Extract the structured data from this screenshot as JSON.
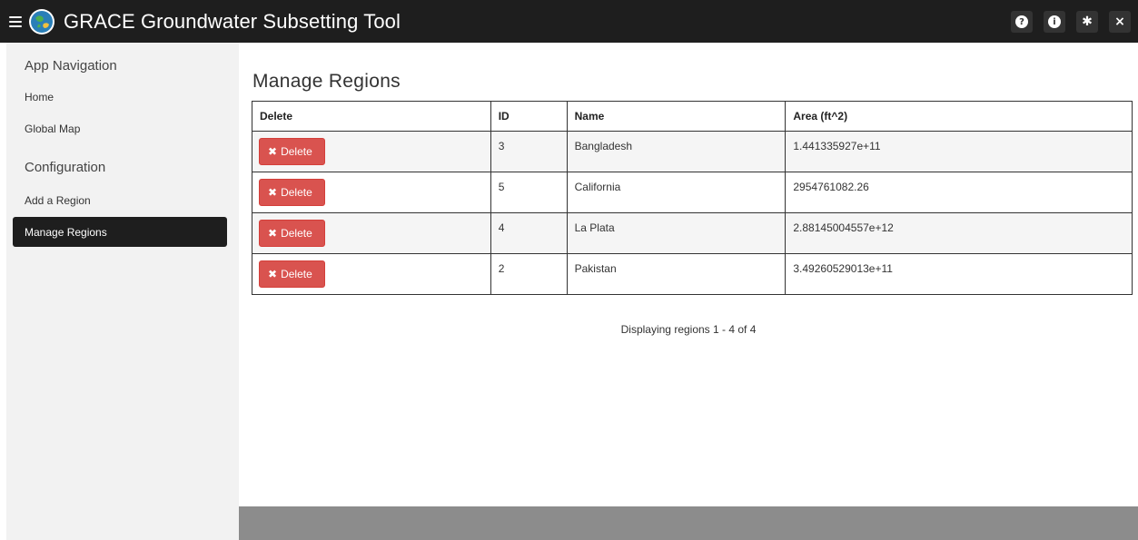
{
  "header": {
    "title": "GRACE Groundwater Subsetting Tool",
    "buttons": [
      {
        "icon": "question-circle-icon",
        "glyph": "?"
      },
      {
        "icon": "info-circle-icon",
        "glyph": "i"
      },
      {
        "icon": "gear-icon",
        "glyph": "✱"
      },
      {
        "icon": "close-icon",
        "glyph": "×"
      }
    ]
  },
  "sidebar": {
    "app_nav_header": "App Navigation",
    "home": "Home",
    "global_map": "Global Map",
    "config_header": "Configuration",
    "add_region": "Add a Region",
    "manage_regions": "Manage Regions"
  },
  "main": {
    "page_title": "Manage Regions",
    "table": {
      "headers": [
        "Delete",
        "ID",
        "Name",
        "Area (ft^2)"
      ],
      "rows": [
        {
          "delete_label": "Delete",
          "id": "3",
          "name": "Bangladesh",
          "area": "1.441335927e+11"
        },
        {
          "delete_label": "Delete",
          "id": "5",
          "name": "California",
          "area": "2954761082.26"
        },
        {
          "delete_label": "Delete",
          "id": "4",
          "name": "La Plata",
          "area": "2.88145004557e+12"
        },
        {
          "delete_label": "Delete",
          "id": "2",
          "name": "Pakistan",
          "area": "3.49260529013e+11"
        }
      ]
    },
    "status_text": "Displaying regions 1 - 4 of 4"
  },
  "colors": {
    "header_bg": "#1e1e1e",
    "sidebar_bg": "#f2f2f2",
    "danger": "#d9534f",
    "bottom_bar": "#8c8c8c"
  }
}
